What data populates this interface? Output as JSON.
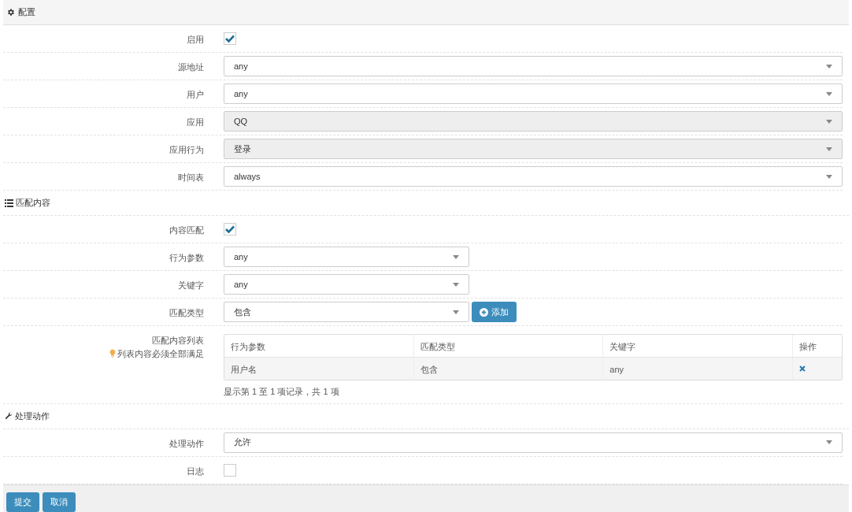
{
  "sections": [
    {
      "kind": "panel",
      "title": "配置",
      "rows": [
        {
          "kind": "checkbox",
          "label": "启用",
          "checked": true
        },
        {
          "kind": "select",
          "label": "源地址",
          "value": "any",
          "disabled": false,
          "compact": false
        },
        {
          "kind": "select",
          "label": "用户",
          "value": "any",
          "disabled": false,
          "compact": false
        },
        {
          "kind": "select",
          "label": "应用",
          "value": "QQ",
          "disabled": true,
          "compact": false
        },
        {
          "kind": "select",
          "label": "应用行为",
          "value": "登录",
          "disabled": true,
          "compact": false
        },
        {
          "kind": "select",
          "label": "时间表",
          "value": "always",
          "disabled": false,
          "compact": false
        }
      ]
    },
    {
      "kind": "group",
      "title": "匹配内容",
      "rows": [
        {
          "kind": "checkbox",
          "label": "内容匹配",
          "checked": true
        },
        {
          "kind": "select",
          "label": "行为参数",
          "value": "any",
          "disabled": false,
          "compact": true
        },
        {
          "kind": "select",
          "label": "关键字",
          "value": "any",
          "disabled": false,
          "compact": true
        },
        {
          "kind": "select",
          "label": "匹配类型",
          "value": "包含",
          "disabled": false,
          "compact": true,
          "button": "添加"
        },
        {
          "kind": "table",
          "label": "匹配内容列表",
          "hint": "列表内容必须全部满足",
          "columns": [
            "行为参数",
            "匹配类型",
            "关键字",
            "操作"
          ],
          "rows": [
            [
              "用户名",
              "包含",
              "any"
            ]
          ],
          "summary": "显示第 1 至 1 项记录，共 1 项"
        }
      ]
    },
    {
      "kind": "group",
      "title": "处理动作",
      "rows": [
        {
          "kind": "select",
          "label": "处理动作",
          "value": "允许",
          "disabled": false,
          "compact": false
        },
        {
          "kind": "checkbox",
          "label": "日志",
          "checked": false
        }
      ]
    }
  ],
  "buttons": [
    "提交",
    "取消"
  ]
}
